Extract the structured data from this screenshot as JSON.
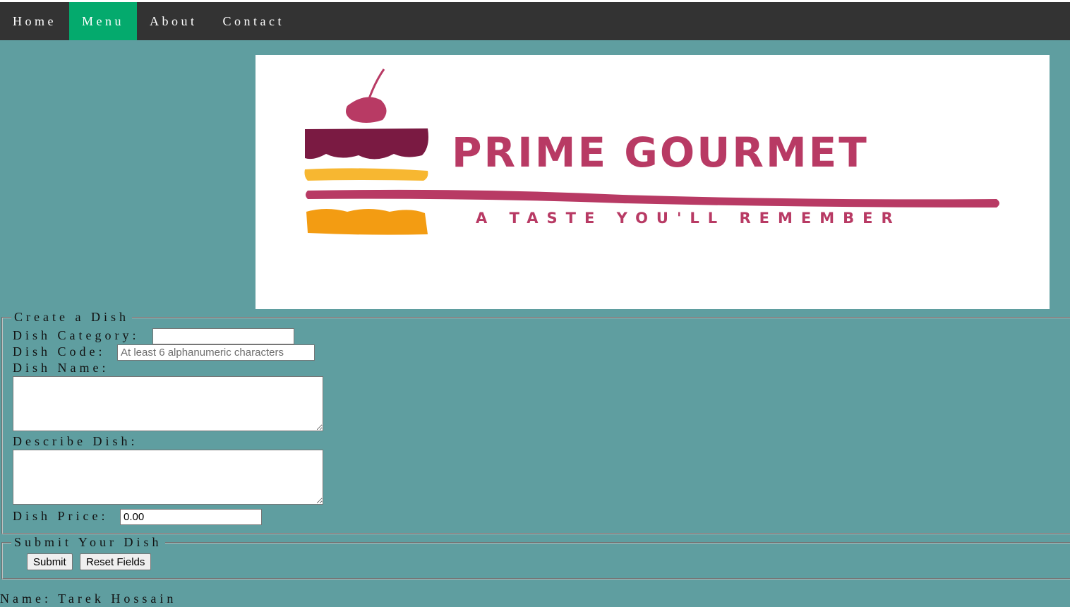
{
  "nav": {
    "items": [
      {
        "label": "Home"
      },
      {
        "label": "Menu"
      },
      {
        "label": "About"
      },
      {
        "label": "Contact"
      }
    ],
    "active": "Menu",
    "colors": {
      "bar": "#333333",
      "active": "#04aa6d",
      "text": "#ffffff"
    }
  },
  "banner": {
    "brand": "PRIME GOURMET",
    "tagline": "A TASTE YOU'LL REMEMBER",
    "colors": {
      "brand": "#b83a64",
      "dark": "#7a1a42",
      "yellow": "#f7b731",
      "orange": "#f39c12"
    }
  },
  "create_form": {
    "legend": "Create a Dish",
    "category_label": "Dish Category:",
    "category_value": "",
    "code_label": "Dish Code:",
    "code_placeholder": "At least 6 alphanumeric characters",
    "name_label": "Dish Name:",
    "describe_label": "Describe Dish:",
    "price_label": "Dish Price:",
    "price_value": "0.00"
  },
  "submit_form": {
    "legend": "Submit Your Dish",
    "submit_label": "Submit",
    "reset_label": "Reset Fields"
  },
  "footer": {
    "name_text": "Name: Tarek Hossain"
  },
  "page_background": "#5f9ea0"
}
